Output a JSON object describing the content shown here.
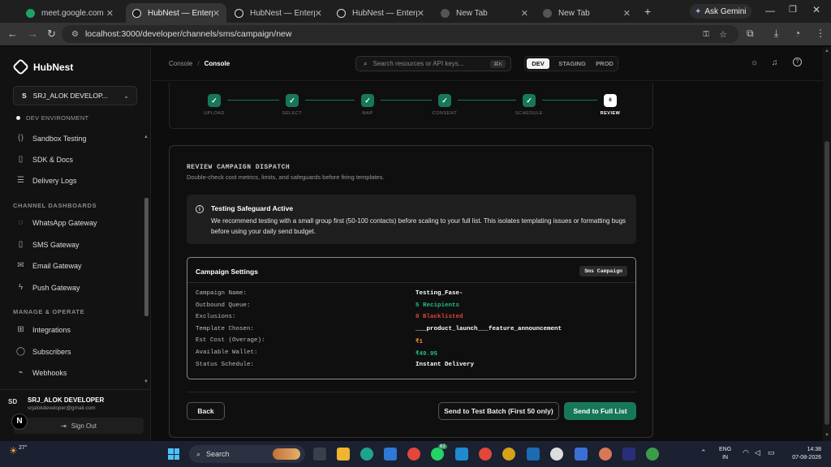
{
  "browser": {
    "tabs": [
      {
        "title": "meet.google.com",
        "active": false,
        "color": "#1ea362"
      },
      {
        "title": "HubNest — Enterprise",
        "active": true,
        "color": "#1a1a1a"
      },
      {
        "title": "HubNest — Enterprise",
        "active": false,
        "color": "#1a1a1a"
      },
      {
        "title": "HubNest — Enterprise",
        "active": false,
        "color": "#1a1a1a"
      },
      {
        "title": "New Tab",
        "active": false,
        "color": "#555555"
      },
      {
        "title": "New Tab",
        "active": false,
        "color": "#555555"
      }
    ],
    "gemini_label": "Ask Gemini",
    "url": "localhost:3000/developer/channels/sms/campaign/new"
  },
  "sidebar": {
    "brand": "HubNest",
    "workspace": {
      "initial": "S",
      "name": "SRJ_ALOK DEVELOP..."
    },
    "environment": "DEV ENVIRONMENT",
    "items_top": [
      {
        "label": "Sandbox Testing",
        "icon": "code-icon"
      },
      {
        "label": "SDK & Docs",
        "icon": "book-icon"
      },
      {
        "label": "Delivery Logs",
        "icon": "list-icon"
      }
    ],
    "section_channels": "CHANNEL DASHBOARDS",
    "channels": [
      {
        "label": "WhatsApp Gateway",
        "icon": "chat-icon"
      },
      {
        "label": "SMS Gateway",
        "icon": "phone-icon"
      },
      {
        "label": "Email Gateway",
        "icon": "mail-icon"
      },
      {
        "label": "Push Gateway",
        "icon": "bolt-icon"
      }
    ],
    "section_manage": "MANAGE & OPERATE",
    "manage": [
      {
        "label": "Integrations",
        "icon": "grid-icon"
      },
      {
        "label": "Subscribers",
        "icon": "user-icon"
      },
      {
        "label": "Webhooks",
        "icon": "webhook-icon"
      }
    ],
    "user": {
      "initials": "SD",
      "name": "SRJ_ALOK DEVELOPER",
      "email": "srjalokdeveloper@gmail.com"
    },
    "sign_out": "Sign Out"
  },
  "topbar": {
    "breadcrumb_root": "Console",
    "breadcrumb_sep": "/",
    "breadcrumb_current": "Console",
    "search_placeholder": "Search resources or API keys...",
    "search_shortcut": "⌘K",
    "envs": [
      "DEV",
      "STAGING",
      "PROD"
    ],
    "active_env": "DEV"
  },
  "stepper": {
    "steps": [
      {
        "label": "UPLOAD",
        "mark": "✓"
      },
      {
        "label": "SELECT",
        "mark": "✓"
      },
      {
        "label": "MAP",
        "mark": "✓"
      },
      {
        "label": "CONSENT",
        "mark": "✓"
      },
      {
        "label": "SCHEDULE",
        "mark": "✓"
      },
      {
        "label": "REVIEW",
        "mark": "6"
      }
    ]
  },
  "review": {
    "title": "REVIEW CAMPAIGN DISPATCH",
    "subtitle": "Double-check cost metrics, limits, and safeguards before firing templates.",
    "safeguard_title": "Testing Safeguard Active",
    "safeguard_text": "We recommend testing with a small group first (50-100 contacts) before scaling to your full list. This isolates templating issues or formatting bugs before using your daily send budget.",
    "settings_title": "Campaign Settings",
    "settings_badge": "Sms Campaign",
    "settings": [
      {
        "key": "Campaign Name:",
        "value": "Testing_Fase-",
        "color": "#ffffff"
      },
      {
        "key": "Outbound Queue:",
        "value": "5 Recipients",
        "color": "#1fbf7f"
      },
      {
        "key": "Exclusions:",
        "value": "0 Blacklisted",
        "color": "#e0453c"
      },
      {
        "key": "Template Chosen:",
        "value": "___product_launch___feature_announcement",
        "color": "#ffffff"
      },
      {
        "key": "Est Cost (Overage):",
        "value": "₹1",
        "color": "#f5893a"
      },
      {
        "key": "Available Wallet:",
        "value": "₹49.95",
        "color": "#1fbf7f"
      },
      {
        "key": "Status Schedule:",
        "value": "Instant Delivery",
        "color": "#ffffff"
      }
    ],
    "back_label": "Back",
    "test_label": "Send to Test Batch (First 50 only)",
    "full_label": "Send to Full List"
  },
  "taskbar": {
    "weather": "27°",
    "search_placeholder": "Search",
    "badge": "83",
    "lang_top": "ENG",
    "lang_bottom": "IN",
    "time": "14:38",
    "date": "07-08-2026"
  },
  "colors": {
    "accent": "#17775a",
    "danger": "#e0453c",
    "warning": "#f5893a"
  }
}
